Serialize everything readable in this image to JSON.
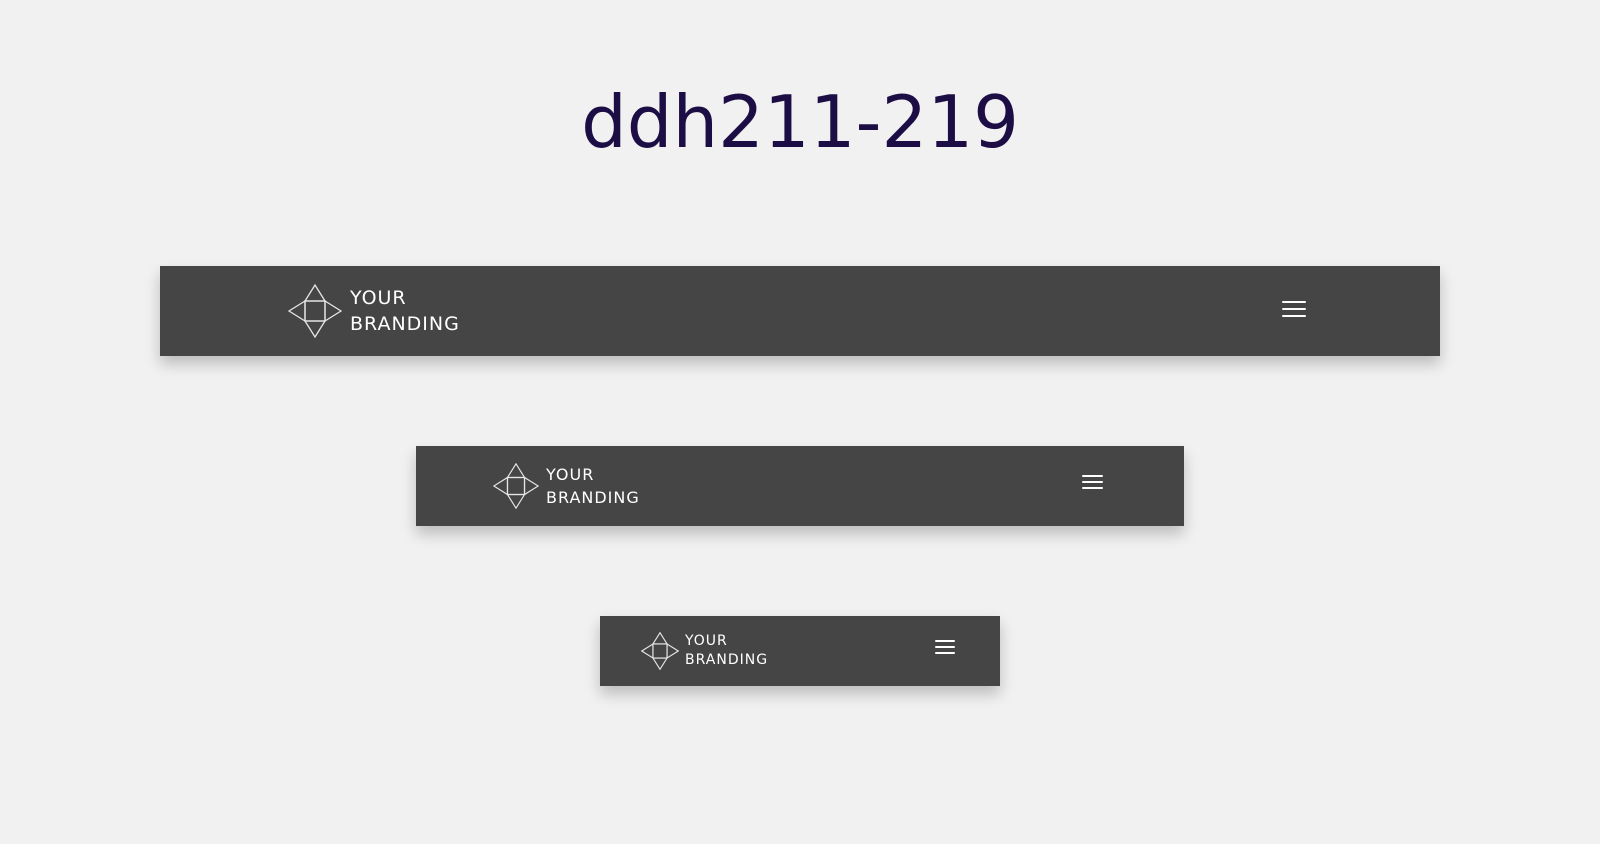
{
  "page": {
    "title": "ddh211-219"
  },
  "navbars": {
    "large": {
      "brand": {
        "line1": "YOUR",
        "line2": "BRANDING",
        "icon": "diamond-logo-icon"
      },
      "menu_icon": "hamburger-menu-icon"
    },
    "medium": {
      "brand": {
        "line1": "YOUR",
        "line2": "BRANDING",
        "icon": "diamond-logo-icon"
      },
      "menu_icon": "hamburger-menu-icon"
    },
    "small": {
      "brand": {
        "line1": "YOUR",
        "line2": "BRANDING",
        "icon": "diamond-logo-icon"
      },
      "menu_icon": "hamburger-menu-icon"
    }
  },
  "colors": {
    "background": "#f1f1f1",
    "navbar": "#454545",
    "title": "#1d0d45",
    "foreground": "#ffffff"
  }
}
